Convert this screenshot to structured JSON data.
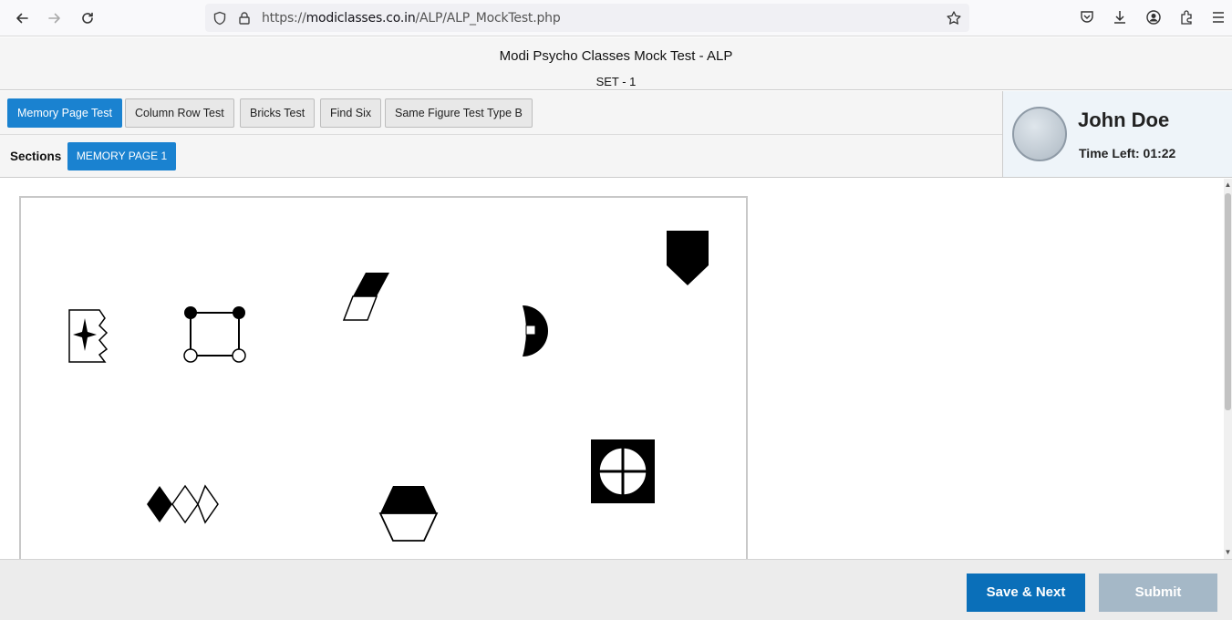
{
  "browser": {
    "url_prefix": "https://",
    "url_host": "modiclasses.co.in",
    "url_path": "/ALP/ALP_MockTest.php"
  },
  "header": {
    "title": "Modi Psycho Classes Mock Test - ALP",
    "set_label": "SET - 1"
  },
  "tests": [
    {
      "label": "Memory Page Test",
      "active": true
    },
    {
      "label": "Column Row Test",
      "active": false
    },
    {
      "label": "Bricks Test",
      "active": false
    },
    {
      "label": "Find Six",
      "active": false
    },
    {
      "label": "Same Figure Test Type B",
      "active": false
    }
  ],
  "sections": {
    "label": "Sections",
    "items": [
      "MEMORY PAGE 1"
    ]
  },
  "candidate": {
    "name": "John Doe",
    "time_left": "Time Left: 01:22"
  },
  "footer": {
    "save_next": "Save & Next",
    "submit": "Submit"
  },
  "colors": {
    "accent": "#1a82d0",
    "save_button": "#0a6fb9",
    "submit_button": "#a5b8c7"
  },
  "figures": [
    "bookmark-star-figure",
    "square-with-circles-figure",
    "half-filled-parallelogram-figure",
    "half-circle-with-square-figure",
    "shield-pentagon-figure",
    "filled-and-empty-diamonds-figure",
    "half-filled-hexagon-figure",
    "crosshair-circle-figure"
  ]
}
